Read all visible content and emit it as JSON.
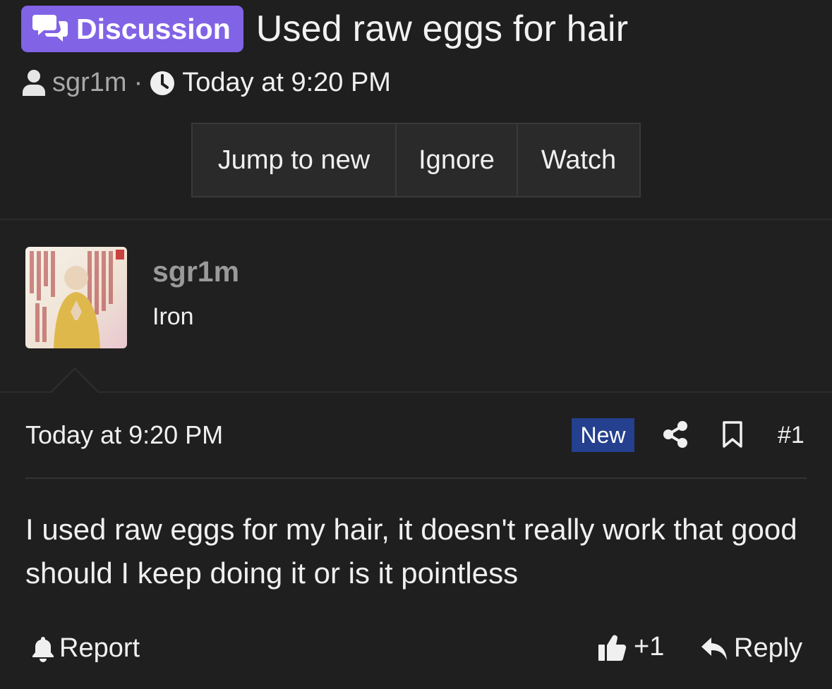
{
  "thread": {
    "prefix": "Discussion",
    "title": "Used raw eggs for hair",
    "author": "sgr1m",
    "separator": "·",
    "date": "Today at 9:20 PM"
  },
  "thread_actions": {
    "jump": "Jump to new",
    "ignore": "Ignore",
    "watch": "Watch"
  },
  "post": {
    "username": "sgr1m",
    "user_title": "Iron",
    "date": "Today at 9:20 PM",
    "new_label": "New",
    "number": "#1",
    "body": "I used raw eggs for my hair, it doesn't really work that good should I keep doing it or is it pointless"
  },
  "post_actions": {
    "report": "Report",
    "like": "+1",
    "reply": "Reply"
  },
  "icons": {
    "badge": "chat-bubbles-icon",
    "author": "user-icon",
    "date": "clock-icon",
    "share": "share-icon",
    "bookmark": "bookmark-icon",
    "report": "bell-icon",
    "like": "thumbs-up-icon",
    "reply": "reply-arrow-icon"
  },
  "colors": {
    "background": "#1f1f1f",
    "prefix_badge": "#8163e6",
    "new_badge": "#24408e",
    "muted_text": "#a8a8a8"
  }
}
